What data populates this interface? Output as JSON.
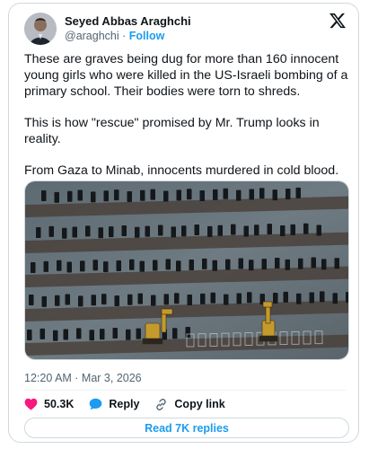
{
  "author": {
    "name": "Seyed Abbas Araghchi",
    "handle": "@araghchi",
    "separator": "·",
    "follow_label": "Follow"
  },
  "tweet": {
    "paragraphs": [
      "These are graves being dug for more than 160 innocent young girls who were killed in the US-Israeli bombing of a primary school. Their bodies were torn to shreds.",
      "This is how \"rescue\" promised by Mr. Trump looks in reality.",
      "From Gaza to Minab, innocents murdered in cold blood."
    ],
    "timestamp": "12:20 AM · Mar 3, 2026"
  },
  "media": {
    "icon": "aerial-photo-graves"
  },
  "actions": {
    "likes_count": "50.3K",
    "reply_label": "Reply",
    "copy_link_label": "Copy link",
    "read_replies_label": "Read 7K replies"
  },
  "colors": {
    "accent": "#1d9bf0",
    "like": "#f91880",
    "text": "#0f1419",
    "muted": "#536471"
  }
}
